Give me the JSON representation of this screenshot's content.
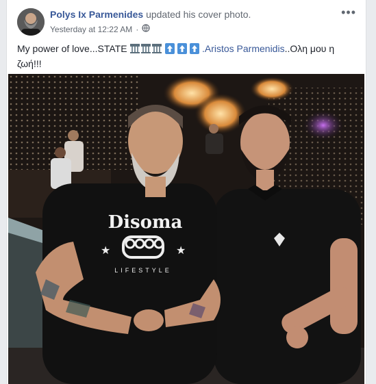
{
  "post": {
    "author": "Polys Ix Parmenides",
    "action": "updated his cover photo.",
    "timestamp": "Yesterday at 12:22 AM",
    "separator": "·",
    "privacy_icon": "globe-icon",
    "more_icon": "more-options-icon",
    "text_before": "My power of love...STATE",
    "text_link": ".Aristos Parmenidis",
    "text_after": "..Ολη μου η ζωή!!!",
    "emoji_sequence": [
      "flag-icon",
      "flag-icon",
      "flag-icon",
      "up-arrow-icon",
      "up-arrow-icon",
      "up-arrow-icon"
    ]
  },
  "photo": {
    "shirt_left_brand": "Disoma",
    "shirt_left_sub": "LIFESTYLE"
  },
  "colors": {
    "link": "#385898",
    "text": "#1d2129",
    "meta": "#616770",
    "background": "#e9ebee"
  }
}
